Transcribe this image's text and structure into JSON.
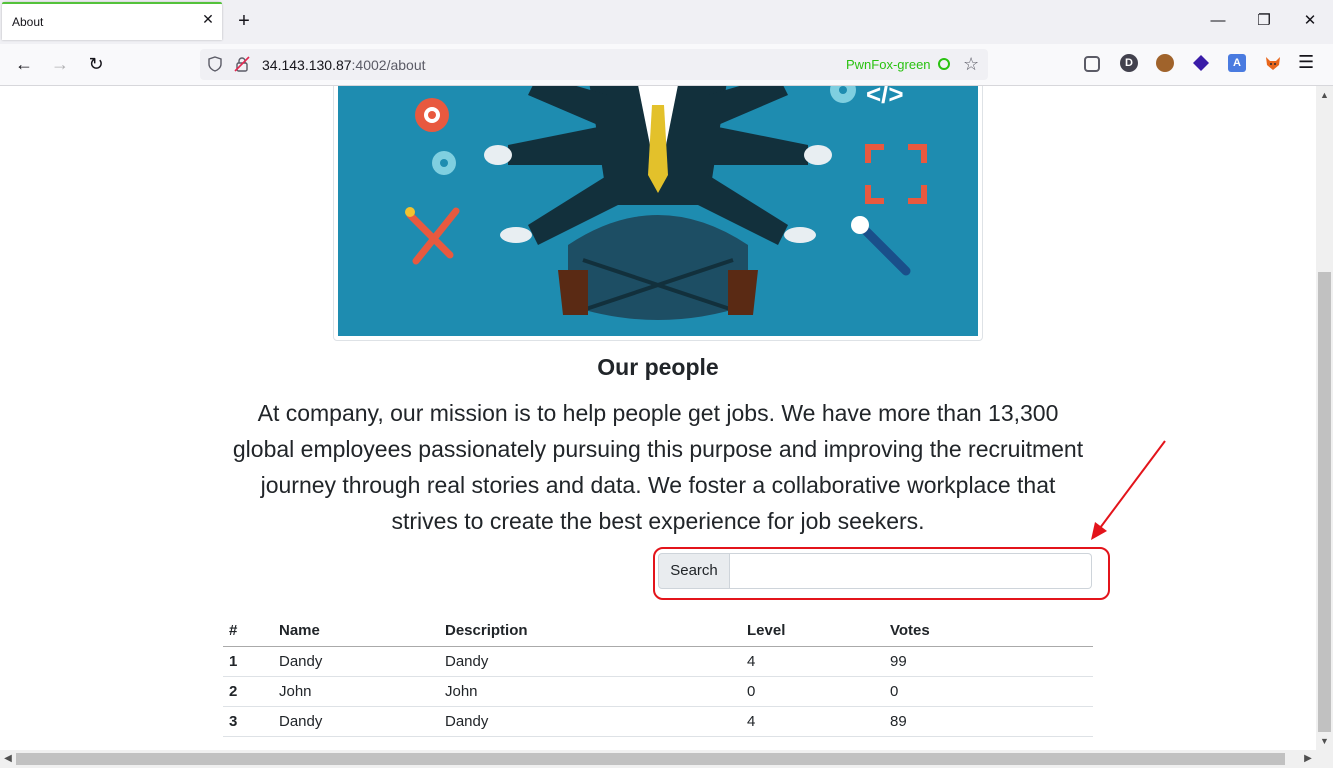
{
  "browser": {
    "tab_title": "About",
    "url_host": "34.143.130.87",
    "url_rest": ":4002/about",
    "container_name": "PwnFox-green",
    "extensions": [
      "pocket-icon",
      "d-extension-icon",
      "cookie-icon",
      "diamond-icon",
      "translate-icon",
      "fox-icon"
    ],
    "accent_color": "#2ac211"
  },
  "page": {
    "heading": "Our people",
    "mission": "At company, our mission is to help people get jobs. We have more than 13,300 global employees passionately pursuing this purpose and improving the recruitment journey through real stories and data. We foster a collaborative workplace that strives to create the best experience for job seekers.",
    "search": {
      "label": "Search",
      "value": ""
    },
    "table": {
      "headers": [
        "#",
        "Name",
        "Description",
        "Level",
        "Votes"
      ],
      "rows": [
        {
          "num": "1",
          "name": "Dandy",
          "description": "Dandy",
          "level": "4",
          "votes": "99"
        },
        {
          "num": "2",
          "name": "John",
          "description": "John",
          "level": "0",
          "votes": "0"
        },
        {
          "num": "3",
          "name": "Dandy",
          "description": "Dandy",
          "level": "4",
          "votes": "89"
        }
      ]
    }
  },
  "annotation_color": "#e3141b"
}
